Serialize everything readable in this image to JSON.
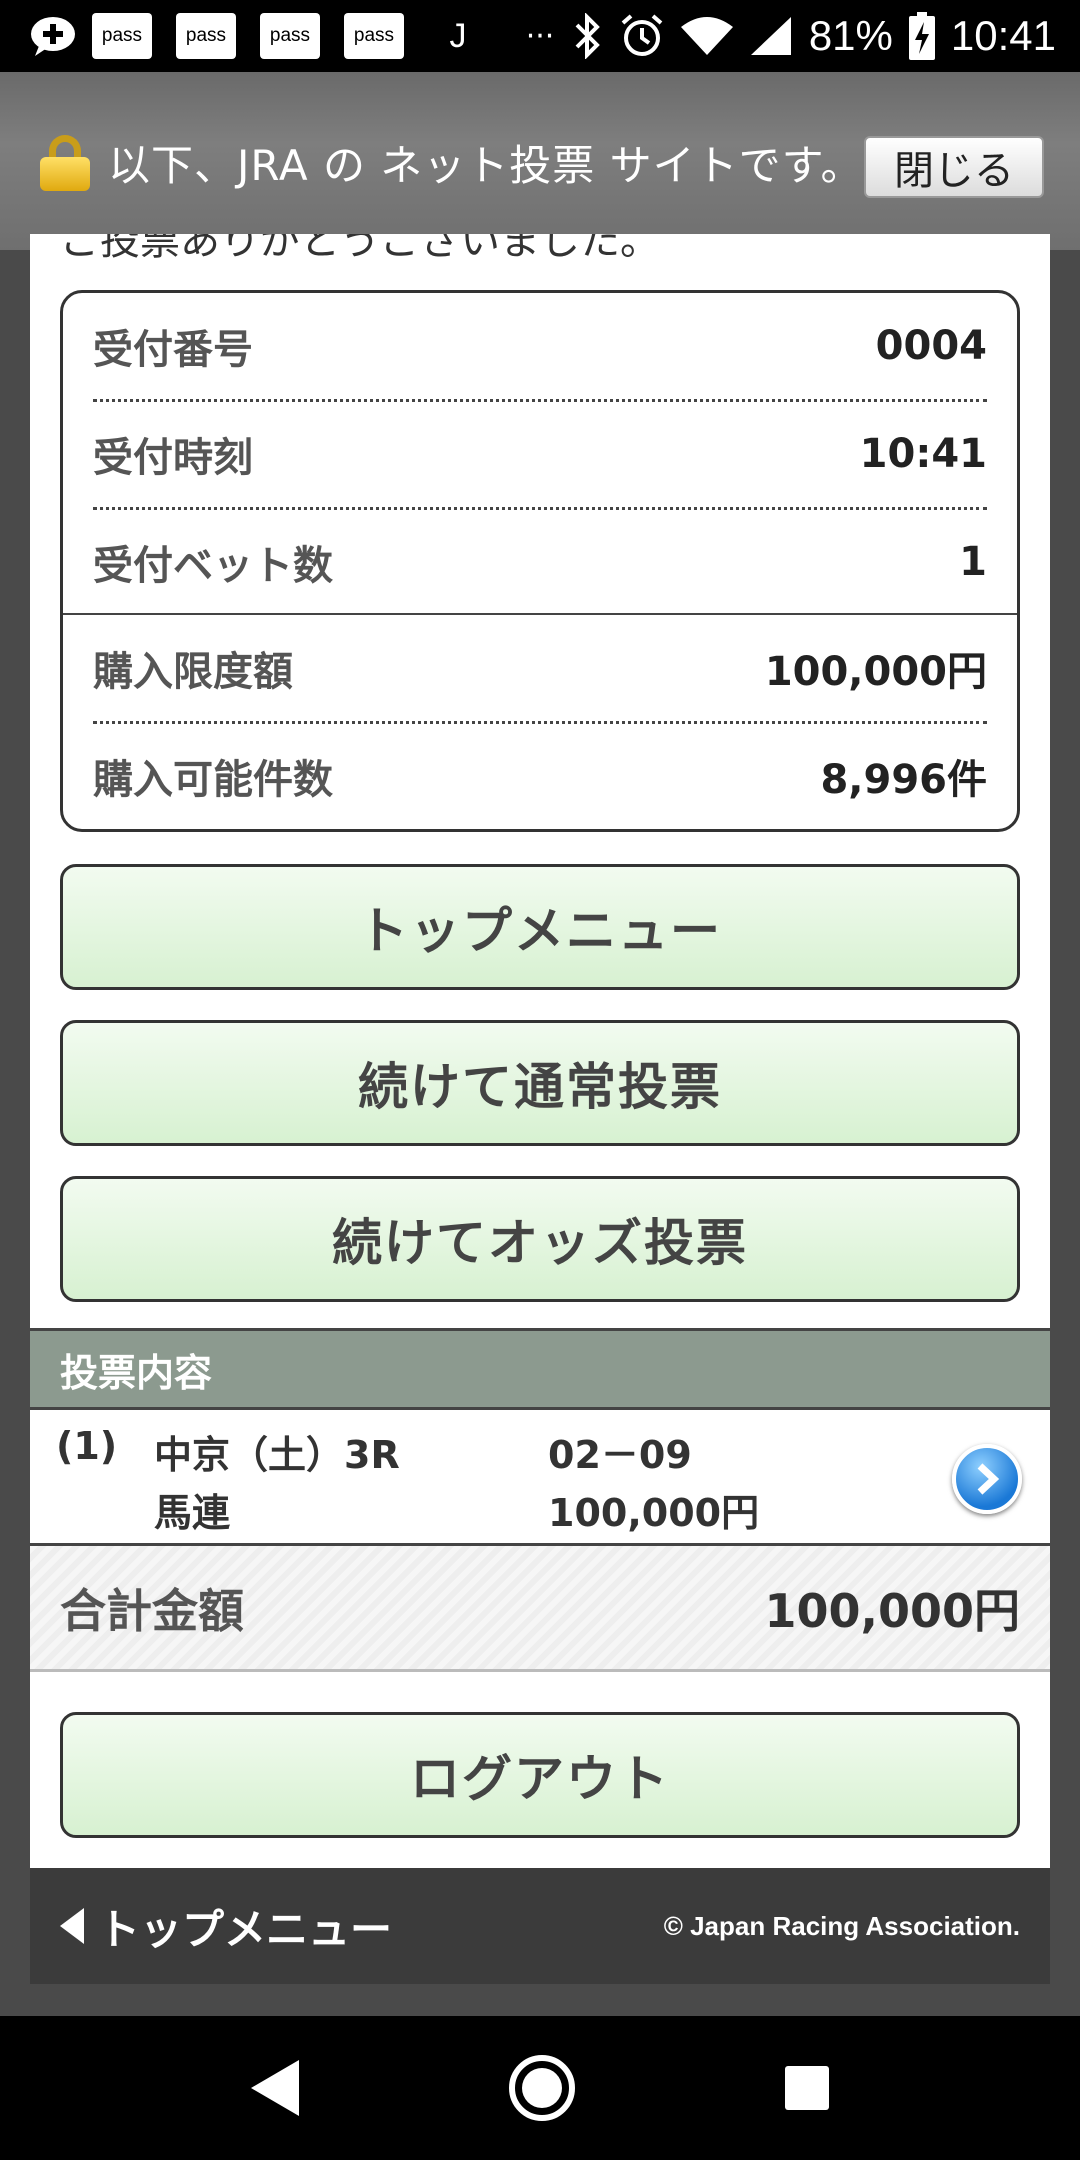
{
  "status_bar": {
    "pass_labels": [
      "pass",
      "pass",
      "pass",
      "pass"
    ],
    "j_label": "J",
    "more": "···",
    "battery": "81%",
    "time": "10:41"
  },
  "banner": {
    "text": "以下、JRA の ネット投票 サイトです。",
    "close_label": "閉じる"
  },
  "page": {
    "thanks_text": "ご投票ありがとうございました。",
    "info": {
      "receipt_no_label": "受付番号",
      "receipt_no": "0004",
      "receipt_time_label": "受付時刻",
      "receipt_time": "10:41",
      "bet_count_label": "受付ベット数",
      "bet_count": "1",
      "limit_label": "購入限度額",
      "limit": "100,000円",
      "remaining_label": "購入可能件数",
      "remaining": "8,996件"
    },
    "buttons": {
      "top_menu": "トップメニュー",
      "continue_normal": "続けて通常投票",
      "continue_odds": "続けてオッズ投票",
      "logout": "ログアウト"
    },
    "bets_section_title": "投票内容",
    "bets": [
      {
        "index": "(1)",
        "race": "中京（土）3R",
        "type": "馬連",
        "combo": "02－09",
        "amount": "100,000円"
      }
    ],
    "total_label": "合計金額",
    "total_value": "100,000円",
    "footer": {
      "back_label": "トップメニュー",
      "copyright": "© Japan Racing Association."
    }
  }
}
